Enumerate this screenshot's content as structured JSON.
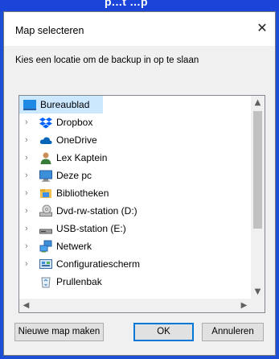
{
  "header": {
    "partial_text": "p...t ...p"
  },
  "dialog": {
    "title": "Map selecteren",
    "close_glyph": "✕",
    "instruction": "Kies een locatie om de backup in op te slaan"
  },
  "tree": {
    "root": {
      "label": "Bureaublad",
      "icon": "desktop-icon",
      "selected": true
    },
    "items": [
      {
        "label": "Dropbox",
        "icon": "dropbox-icon",
        "expandable": true
      },
      {
        "label": "OneDrive",
        "icon": "onedrive-cloud-icon",
        "expandable": true
      },
      {
        "label": "Lex Kaptein",
        "icon": "user-icon",
        "expandable": true
      },
      {
        "label": "Deze pc",
        "icon": "computer-icon",
        "expandable": true
      },
      {
        "label": "Bibliotheken",
        "icon": "libraries-icon",
        "expandable": true
      },
      {
        "label": "Dvd-rw-station (D:)",
        "icon": "dvd-drive-icon",
        "expandable": true
      },
      {
        "label": "USB-station (E:)",
        "icon": "usb-drive-icon",
        "expandable": true
      },
      {
        "label": "Netwerk",
        "icon": "network-icon",
        "expandable": true
      },
      {
        "label": "Configuratiescherm",
        "icon": "control-panel-icon",
        "expandable": true
      },
      {
        "label": "Prullenbak",
        "icon": "recycle-bin-icon",
        "expandable": false
      }
    ]
  },
  "buttons": {
    "new_folder": "Nieuwe map maken",
    "ok": "OK",
    "cancel": "Annuleren"
  },
  "colors": {
    "background_blue": "#1a4fd6",
    "selection": "#cce8ff",
    "accent": "#0078d7"
  }
}
